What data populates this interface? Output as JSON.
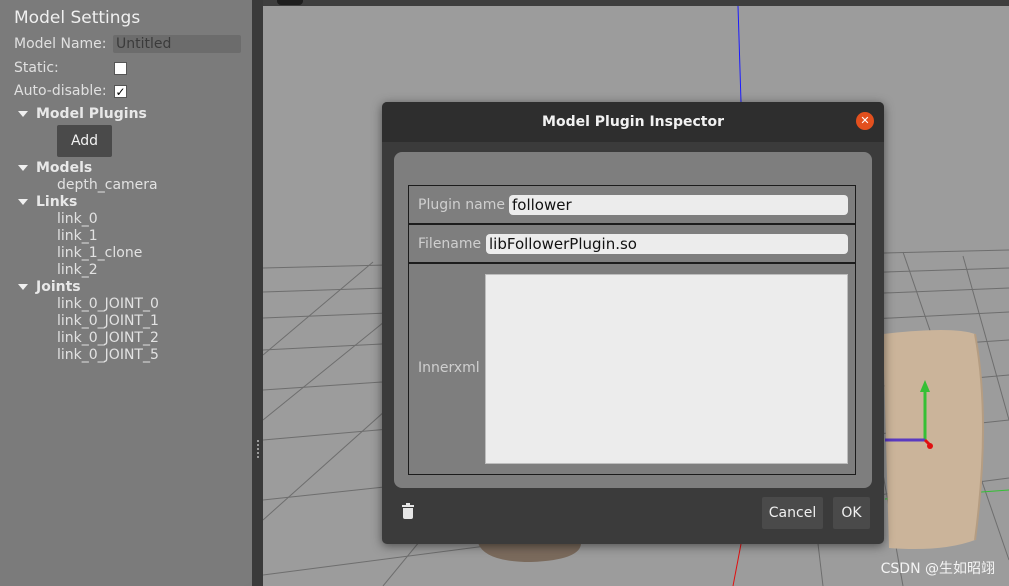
{
  "left_panel": {
    "title": "Model Settings",
    "model_name_label": "Model Name:",
    "model_name_value": "Untitled",
    "static_label": "Static:",
    "static_checked": false,
    "auto_disable_label": "Auto-disable:",
    "auto_disable_check": "✓",
    "plugins_section": "Model Plugins",
    "add_button": "Add",
    "models_section": "Models",
    "models": [
      "depth_camera"
    ],
    "links_section": "Links",
    "links": [
      "link_0",
      "link_1",
      "link_1_clone",
      "link_2"
    ],
    "joints_section": "Joints",
    "joints": [
      "link_0_JOINT_0",
      "link_0_JOINT_1",
      "link_0_JOINT_2",
      "link_0_JOINT_5"
    ]
  },
  "dialog": {
    "title": "Model Plugin Inspector",
    "plugin_name_label": "Plugin name",
    "plugin_name_value": "follower",
    "filename_label": "Filename",
    "filename_value": "libFollowerPlugin.so",
    "innerxml_label": "Innerxml",
    "innerxml_value": "",
    "cancel_button": "Cancel",
    "ok_button": "OK"
  },
  "watermark": "CSDN @生如昭翊",
  "colors": {
    "close_button": "#e3501e",
    "axis_blue": "#1a1aff",
    "axis_green": "#35c035",
    "axis_red": "#e01010",
    "cylinder": "#cbb49a"
  }
}
